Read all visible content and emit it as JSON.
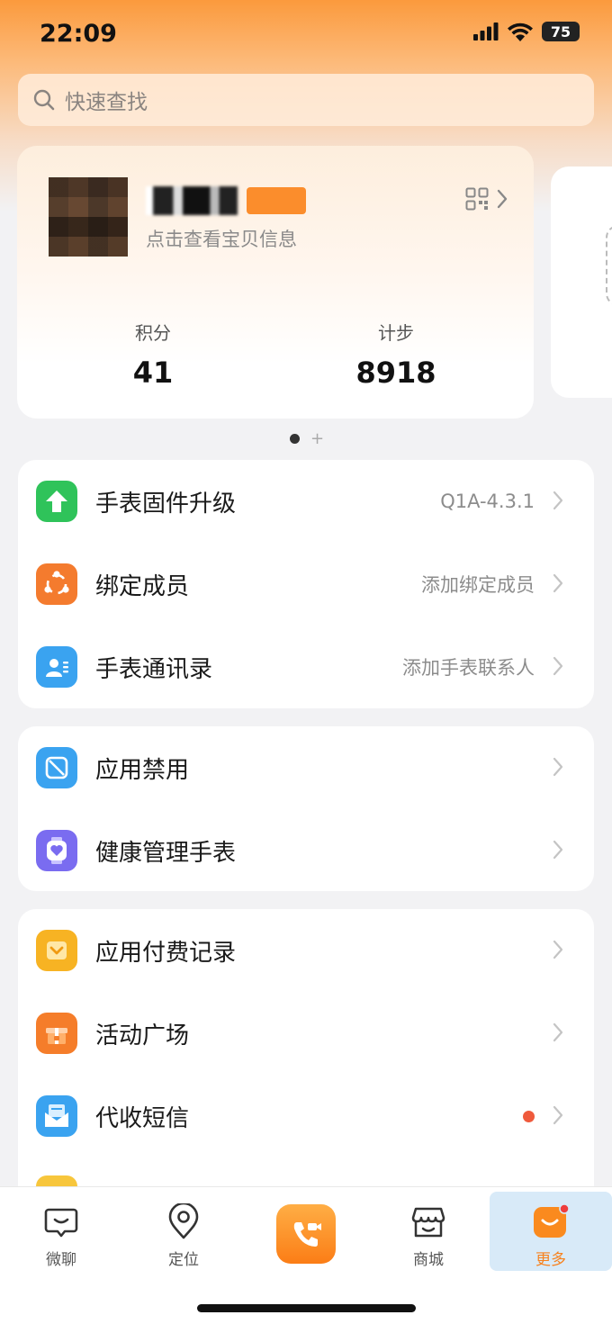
{
  "status_bar": {
    "time": "22:09",
    "battery": "75"
  },
  "search": {
    "placeholder": "快速查找"
  },
  "profile": {
    "subtitle": "点击查看宝贝信息",
    "stats": [
      {
        "label": "积分",
        "value": "41"
      },
      {
        "label": "计步",
        "value": "8918"
      }
    ]
  },
  "groups": [
    {
      "rows": [
        {
          "label": "手表固件升级",
          "value": "Q1A-4.3.1",
          "icon": "upgrade-arrow-icon",
          "color": "#2fc35a"
        },
        {
          "label": "绑定成员",
          "value": "添加绑定成员",
          "icon": "members-icon",
          "color": "#f47b2e"
        },
        {
          "label": "手表通讯录",
          "value": "添加手表联系人",
          "icon": "contacts-icon",
          "color": "#3aa3f0"
        }
      ]
    },
    {
      "rows": [
        {
          "label": "应用禁用",
          "value": "",
          "icon": "app-ban-icon",
          "color": "#3aa3f0"
        },
        {
          "label": "健康管理手表",
          "value": "",
          "icon": "health-watch-icon",
          "color": "#7a6cf0"
        }
      ]
    },
    {
      "rows": [
        {
          "label": "应用付费记录",
          "value": "",
          "icon": "paid-record-icon",
          "color": "#f7b323"
        },
        {
          "label": "活动广场",
          "value": "",
          "icon": "gift-icon",
          "color": "#f57d2a"
        },
        {
          "label": "代收短信",
          "value": "",
          "icon": "sms-icon",
          "color": "#3aa3f0",
          "badge_dot": true
        }
      ]
    }
  ],
  "tabbar": {
    "tabs": [
      {
        "label": "微聊",
        "icon": "chat-icon"
      },
      {
        "label": "定位",
        "icon": "location-icon"
      },
      {
        "label": "",
        "icon": "video-call-icon"
      },
      {
        "label": "商城",
        "icon": "shop-icon"
      },
      {
        "label": "更多",
        "icon": "more-icon",
        "active": true
      }
    ],
    "active_color": "#f7821e"
  }
}
